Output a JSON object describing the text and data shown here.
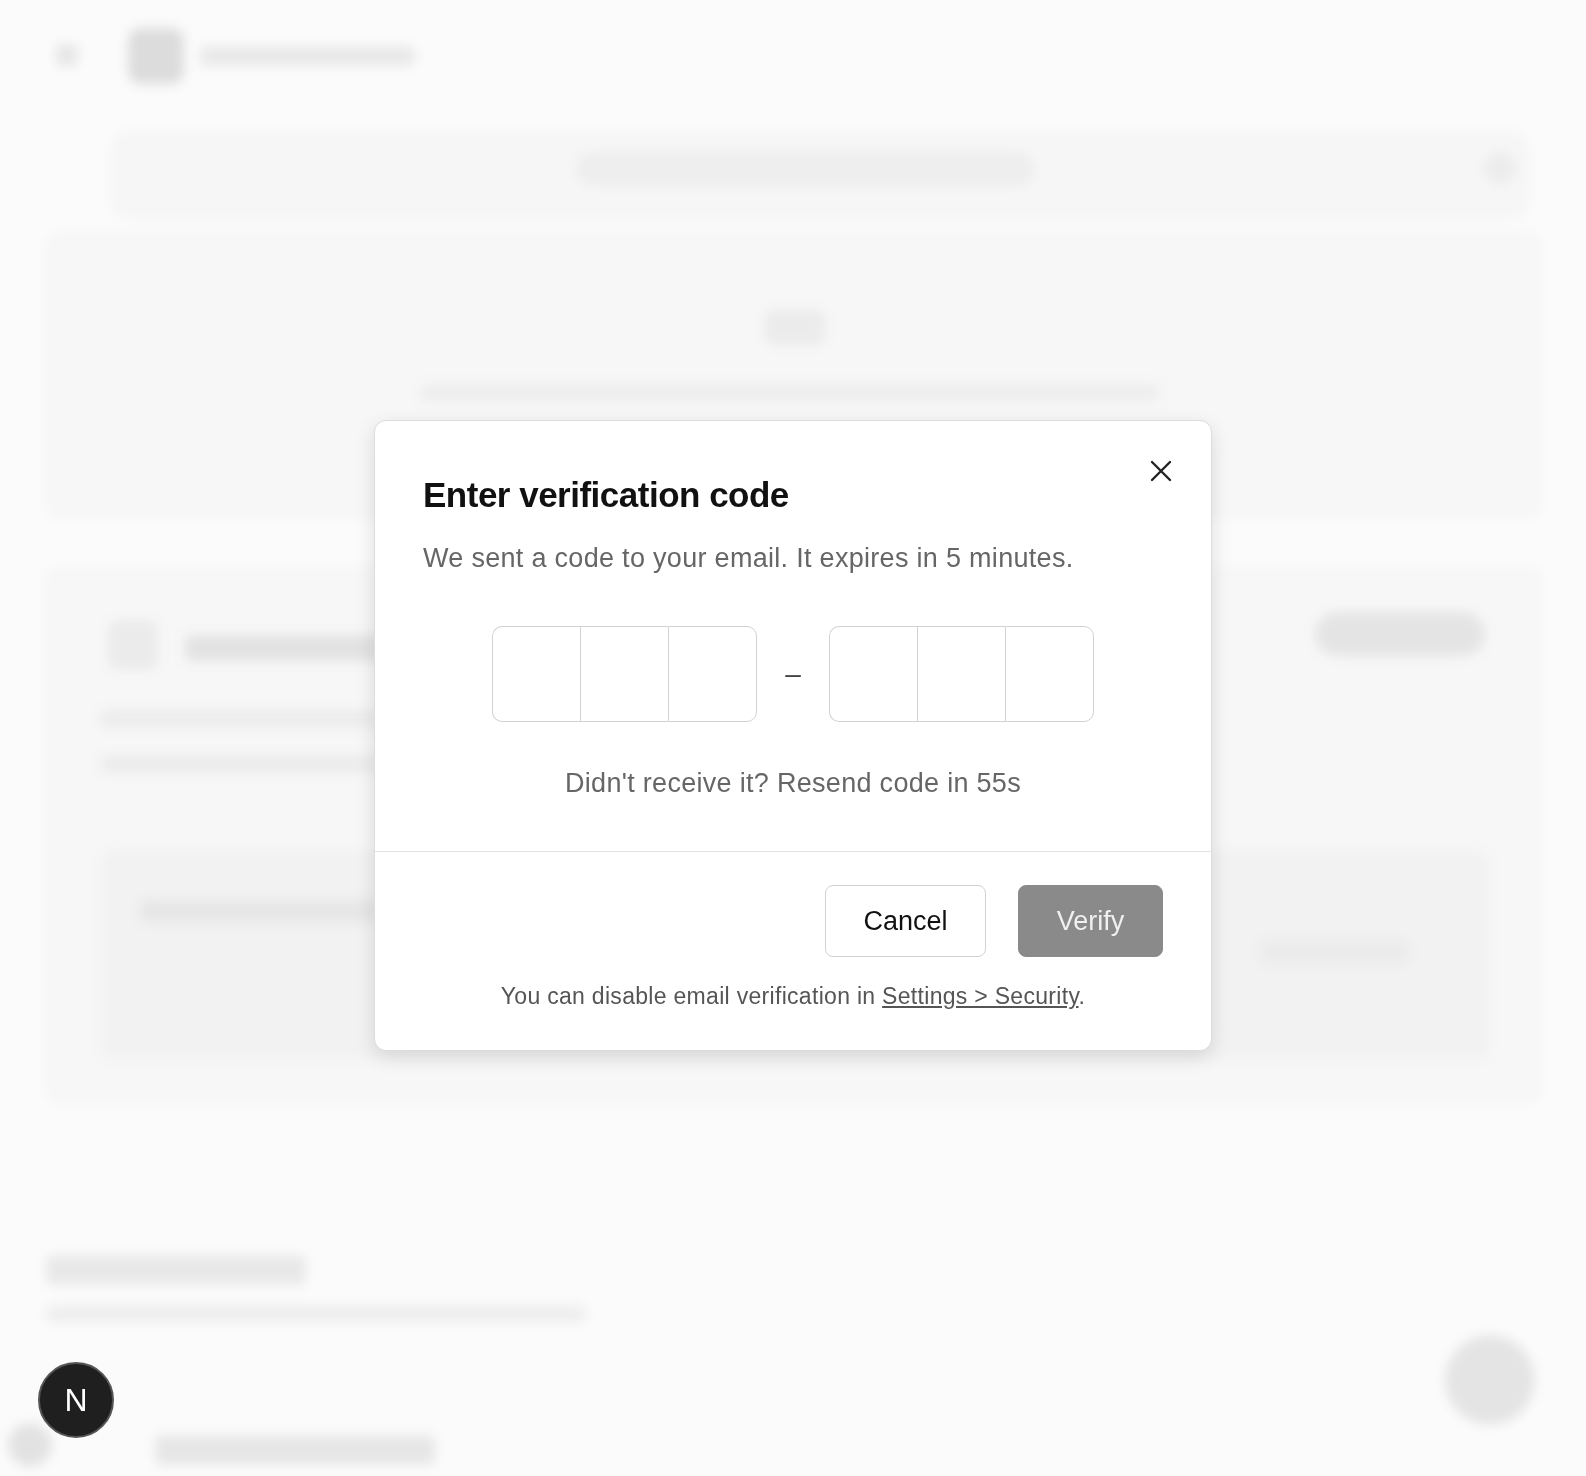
{
  "dialog": {
    "title": "Enter verification code",
    "description": "We sent a code to your email. It expires in 5 minutes.",
    "code_groups": [
      {
        "cells": [
          {
            "filled": false
          },
          {
            "filled": false
          },
          {
            "filled": false
          }
        ]
      },
      {
        "cells": [
          {
            "filled": false
          },
          {
            "filled": false
          },
          {
            "filled": false
          }
        ]
      }
    ],
    "separator": "–",
    "resend_text": "Didn't receive it? Resend code in 55s",
    "buttons": [
      {
        "label": "Cancel",
        "kind": "secondary",
        "disabled": false
      },
      {
        "label": "Verify",
        "kind": "primary",
        "disabled": true
      }
    ],
    "footer": {
      "text": "You can disable email verification in ",
      "link": "Settings > Security",
      "end": "."
    }
  },
  "dev_badge": {
    "label": "N"
  }
}
